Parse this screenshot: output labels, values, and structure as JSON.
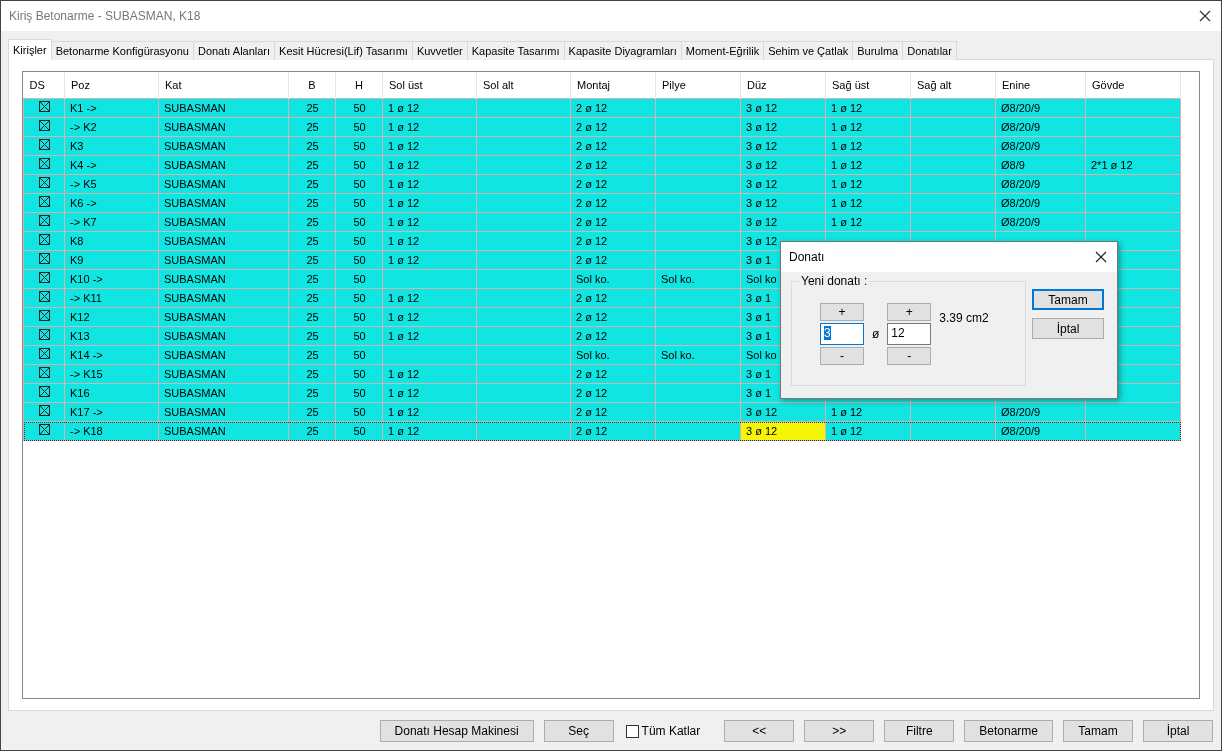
{
  "window": {
    "title": "Kiriş Betonarme - SUBASMAN, K18"
  },
  "tabs": [
    {
      "label": "Kirişler",
      "selected": true
    },
    {
      "label": "Betonarme Konfigürasyonu",
      "selected": false
    },
    {
      "label": "Donatı Alanları",
      "selected": false
    },
    {
      "label": "Kesit Hücresi(Lif) Tasarımı",
      "selected": false
    },
    {
      "label": "Kuvvetler",
      "selected": false
    },
    {
      "label": "Kapasite Tasarımı",
      "selected": false
    },
    {
      "label": "Kapasite Diyagramları",
      "selected": false
    },
    {
      "label": "Moment-Eğrilik",
      "selected": false
    },
    {
      "label": "Sehim ve Çatlak",
      "selected": false
    },
    {
      "label": "Burulma",
      "selected": false
    },
    {
      "label": "Donatılar",
      "selected": false
    }
  ],
  "table": {
    "checkbox_column": "DS",
    "columns": [
      "Poz",
      "Kat",
      "B",
      "H",
      "Sol üst",
      "Sol alt",
      "Montaj",
      "Pilye",
      "Düz",
      "Sağ üst",
      "Sağ alt",
      "Enine",
      "Gövde"
    ],
    "rows": [
      {
        "checked": true,
        "selected": false,
        "cells": [
          "K1 ->",
          "SUBASMAN",
          "25",
          "50",
          "1 ø 12",
          null,
          "2 ø 12",
          null,
          "3 ø 12",
          "1 ø 12",
          null,
          "Ø8/20/9",
          null
        ]
      },
      {
        "checked": true,
        "selected": false,
        "cells": [
          "-> K2",
          "SUBASMAN",
          "25",
          "50",
          "1 ø 12",
          null,
          "2 ø 12",
          null,
          "3 ø 12",
          "1 ø 12",
          null,
          "Ø8/20/9",
          null
        ]
      },
      {
        "checked": true,
        "selected": false,
        "cells": [
          "K3",
          "SUBASMAN",
          "25",
          "50",
          "1 ø 12",
          null,
          "2 ø 12",
          null,
          "3 ø 12",
          "1 ø 12",
          null,
          "Ø8/20/9",
          null
        ]
      },
      {
        "checked": true,
        "selected": false,
        "cells": [
          "K4 ->",
          "SUBASMAN",
          "25",
          "50",
          "1 ø 12",
          null,
          "2 ø 12",
          null,
          "3 ø 12",
          "1 ø 12",
          null,
          "Ø8/9",
          "2*1 ø 12"
        ]
      },
      {
        "checked": true,
        "selected": false,
        "cells": [
          "-> K5",
          "SUBASMAN",
          "25",
          "50",
          "1 ø 12",
          null,
          "2 ø 12",
          null,
          "3 ø 12",
          "1 ø 12",
          null,
          "Ø8/20/9",
          null
        ]
      },
      {
        "checked": true,
        "selected": false,
        "cells": [
          "K6 ->",
          "SUBASMAN",
          "25",
          "50",
          "1 ø 12",
          null,
          "2 ø 12",
          null,
          "3 ø 12",
          "1 ø 12",
          null,
          "Ø8/20/9",
          null
        ]
      },
      {
        "checked": true,
        "selected": false,
        "cells": [
          "-> K7",
          "SUBASMAN",
          "25",
          "50",
          "1 ø 12",
          null,
          "2 ø 12",
          null,
          "3 ø 12",
          "1 ø 12",
          null,
          "Ø8/20/9",
          null
        ]
      },
      {
        "checked": true,
        "selected": false,
        "cells": [
          "K8",
          "SUBASMAN",
          "25",
          "50",
          "1 ø 12",
          null,
          "2 ø 12",
          null,
          "3 ø 12",
          null,
          null,
          null,
          null
        ]
      },
      {
        "checked": true,
        "selected": false,
        "cells": [
          "K9",
          "SUBASMAN",
          "25",
          "50",
          "1 ø 12",
          null,
          "2 ø 12",
          null,
          "3 ø 1",
          null,
          null,
          null,
          null
        ]
      },
      {
        "checked": true,
        "selected": false,
        "cells": [
          "K10 ->",
          "SUBASMAN",
          "25",
          "50",
          null,
          null,
          "Sol ko.",
          "Sol ko.",
          "Sol ko",
          null,
          null,
          null,
          null
        ]
      },
      {
        "checked": true,
        "selected": false,
        "cells": [
          "-> K11",
          "SUBASMAN",
          "25",
          "50",
          "1 ø 12",
          null,
          "2 ø 12",
          null,
          "3 ø 1",
          null,
          null,
          null,
          null
        ]
      },
      {
        "checked": true,
        "selected": false,
        "cells": [
          "K12",
          "SUBASMAN",
          "25",
          "50",
          "1 ø 12",
          null,
          "2 ø 12",
          null,
          "3 ø 1",
          null,
          null,
          null,
          null
        ]
      },
      {
        "checked": true,
        "selected": false,
        "cells": [
          "K13",
          "SUBASMAN",
          "25",
          "50",
          "1 ø 12",
          null,
          "2 ø 12",
          null,
          "3 ø 1",
          null,
          null,
          null,
          null
        ]
      },
      {
        "checked": true,
        "selected": false,
        "cells": [
          "K14 ->",
          "SUBASMAN",
          "25",
          "50",
          null,
          null,
          "Sol ko.",
          "Sol ko.",
          "Sol ko",
          null,
          null,
          null,
          null
        ]
      },
      {
        "checked": true,
        "selected": false,
        "cells": [
          "-> K15",
          "SUBASMAN",
          "25",
          "50",
          "1 ø 12",
          null,
          "2 ø 12",
          null,
          "3 ø 1",
          null,
          null,
          null,
          null
        ]
      },
      {
        "checked": true,
        "selected": false,
        "cells": [
          "K16",
          "SUBASMAN",
          "25",
          "50",
          "1 ø 12",
          null,
          "2 ø 12",
          null,
          "3 ø 1",
          null,
          null,
          null,
          null
        ]
      },
      {
        "checked": true,
        "selected": false,
        "cells": [
          "K17 ->",
          "SUBASMAN",
          "25",
          "50",
          "1 ø 12",
          null,
          "2 ø 12",
          null,
          "3 ø 12",
          "1 ø 12",
          null,
          "Ø8/20/9",
          null
        ]
      },
      {
        "checked": true,
        "selected": true,
        "cells": [
          "-> K18",
          "SUBASMAN",
          "25",
          "50",
          "1 ø 12",
          null,
          "2 ø 12",
          null,
          {
            "text": "3 ø 12",
            "selected": true
          },
          "1 ø 12",
          null,
          "Ø8/20/9",
          null
        ]
      }
    ]
  },
  "dialog": {
    "title": "Donatı",
    "group_label": "Yeni donatı :",
    "separator": "ø",
    "area": "3.39 cm2",
    "fields": [
      {
        "plus": "+",
        "value": "3",
        "focused": true,
        "minus": "-"
      },
      {
        "plus": "+",
        "value": "12",
        "focused": false,
        "minus": "-"
      }
    ],
    "buttons": [
      {
        "label": "Tamam",
        "default": true
      },
      {
        "label": "İptal",
        "default": false
      }
    ]
  },
  "footer": [
    {
      "kind": "button",
      "label": "Donatı Hesap Makinesi"
    },
    {
      "kind": "button",
      "label": "Seç"
    },
    {
      "kind": "checkbox",
      "label": "Tüm Katlar",
      "checked": false
    },
    {
      "kind": "button",
      "label": "<<"
    },
    {
      "kind": "button",
      "label": ">>"
    },
    {
      "kind": "button",
      "label": "Filtre"
    },
    {
      "kind": "button",
      "label": "Betonarme"
    },
    {
      "kind": "button",
      "label": "Tamam"
    },
    {
      "kind": "button",
      "label": "İptal"
    }
  ]
}
